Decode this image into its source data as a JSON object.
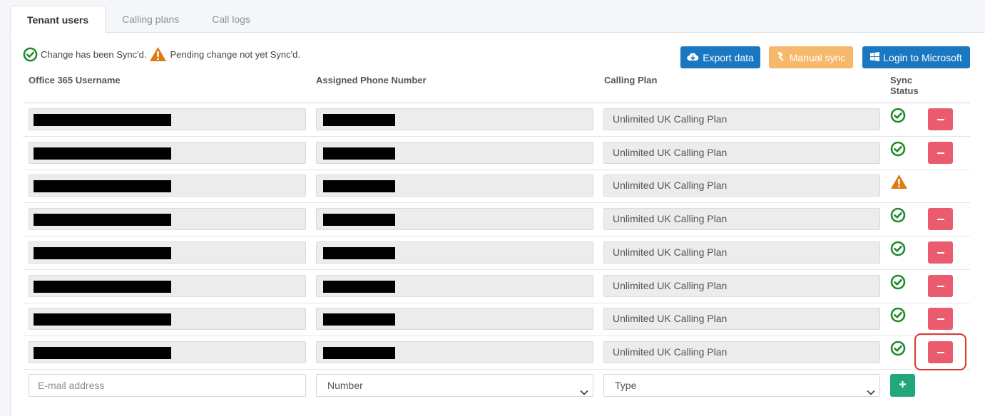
{
  "tabs": [
    {
      "label": "Tenant users",
      "active": true
    },
    {
      "label": "Calling plans",
      "active": false
    },
    {
      "label": "Call logs",
      "active": false
    }
  ],
  "legend": {
    "synced_text": "Change has been Sync'd.",
    "pending_text": "Pending change not yet Sync'd."
  },
  "toolbar": {
    "export_label": "Export data",
    "manual_sync_label": "Manual sync",
    "login_label": "Login to Microsoft"
  },
  "table": {
    "headers": {
      "username": "Office 365 Username",
      "phone": "Assigned Phone Number",
      "plan": "Calling Plan",
      "sync_line1": "Sync",
      "sync_line2": "Status"
    },
    "rows": [
      {
        "plan": "Unlimited UK Calling Plan",
        "sync": "synced",
        "deletable": true
      },
      {
        "plan": "Unlimited UK Calling Plan",
        "sync": "synced",
        "deletable": true
      },
      {
        "plan": "Unlimited UK Calling Plan",
        "sync": "pending",
        "deletable": false
      },
      {
        "plan": "Unlimited UK Calling Plan",
        "sync": "synced",
        "deletable": true
      },
      {
        "plan": "Unlimited UK Calling Plan",
        "sync": "synced",
        "deletable": true
      },
      {
        "plan": "Unlimited UK Calling Plan",
        "sync": "synced",
        "deletable": true
      },
      {
        "plan": "Unlimited UK Calling Plan",
        "sync": "synced",
        "deletable": true
      },
      {
        "plan": "Unlimited UK Calling Plan",
        "sync": "synced",
        "deletable": true
      }
    ]
  },
  "new_row": {
    "email_placeholder": "E-mail address",
    "number_selected": "Number",
    "type_selected": "Type"
  },
  "colors": {
    "primary": "#1a78c2",
    "warning_button": "#f6b96c",
    "danger": "#ea5b6e",
    "success": "#22a77d",
    "sync_ok": "#1e8a2c",
    "sync_pending": "#e07a12",
    "highlight": "#d93b2f"
  },
  "icons": {
    "synced": "check-circle-icon",
    "pending": "warning-triangle-icon",
    "export": "cloud-download-icon",
    "manual_sync": "hammer-icon",
    "login": "windows-logo-icon",
    "delete": "minus-icon",
    "add": "plus-icon",
    "select": "chevron-down-icon"
  }
}
